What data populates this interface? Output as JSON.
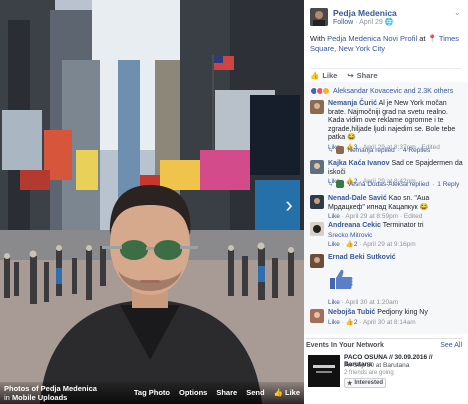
{
  "photo": {
    "album_label": "Photos of Pedja Medenica",
    "album_from_prefix": "in",
    "album_from": "Mobile Uploads",
    "actions": [
      "Tag Photo",
      "Options",
      "Share",
      "Send",
      "Like"
    ],
    "next_arrow": "›"
  },
  "post": {
    "author": "Pedja Medenica",
    "follow": "Follow",
    "date": "April 29",
    "separator": "·",
    "caption_prefix": "With",
    "caption_tag": "Pedja Medenica Novi Profil",
    "caption_at": "at",
    "caption_place": "Times Square, New York City",
    "like_label": "Like",
    "share_label": "Share",
    "reactions_text": "Aleksandar Kovacevic and 2.3K others"
  },
  "comments": [
    {
      "author": "Nemanja Čurić",
      "text": "Al je New York močan brate. Najmočniji grad na svetu realno. Kada vidim ove reklame ogromne i te zgrade,hiljade ljudi najedim se. Bole tebe patka 😂",
      "like": "Like",
      "count": "3",
      "time": "April 29 at 8:37pm · Edited",
      "reply_author": "Nemanja replied",
      "reply_sep": "·",
      "reply_count": "4 Replies"
    },
    {
      "author": "Kajka Kaća Ivanov",
      "text": "Sad ce Spajdermen da iskoči",
      "like": "Like",
      "count": "2",
      "time": "April 29 at 8:42pm",
      "reply_author": "Vesna Dudas-Aleksa replied",
      "reply_sep": "·",
      "reply_count": "1 Reply"
    },
    {
      "author": "Nenad-Dale Savić",
      "text": "Kao sn. \"Aua Mрдацкеф\" ипнад Кацапкук 😂",
      "like": "Like",
      "count": "",
      "time": "April 29 at 8:59pm · Edited"
    },
    {
      "author": "Andreana Cekic",
      "text": "Terminator tri",
      "like": "Srecko Mitrovic",
      "count": "2",
      "time": "April 29 at 9:16pm"
    },
    {
      "author": "Ernad Beki Sutković",
      "text": "",
      "like": "Like",
      "count": "",
      "time": "April 30 at 1:20am"
    },
    {
      "author": "Nebojša Tubić",
      "text": "Pedjony king Ny",
      "like": "Like",
      "count": "2",
      "time": "April 30 at 8:14am"
    }
  ],
  "events": {
    "title": "Events In Your Network",
    "see_all": "See All",
    "name": "PACO OSUNA // 30.09.2016 // Barutana",
    "date": "Fri Sep 30 at Barutana",
    "going": "2 friends are going",
    "interested": "Interested"
  },
  "colors": {
    "link": "#365899",
    "like_blue": "#4267b2",
    "love_red": "#f25268",
    "haha_yellow": "#f7b125"
  }
}
